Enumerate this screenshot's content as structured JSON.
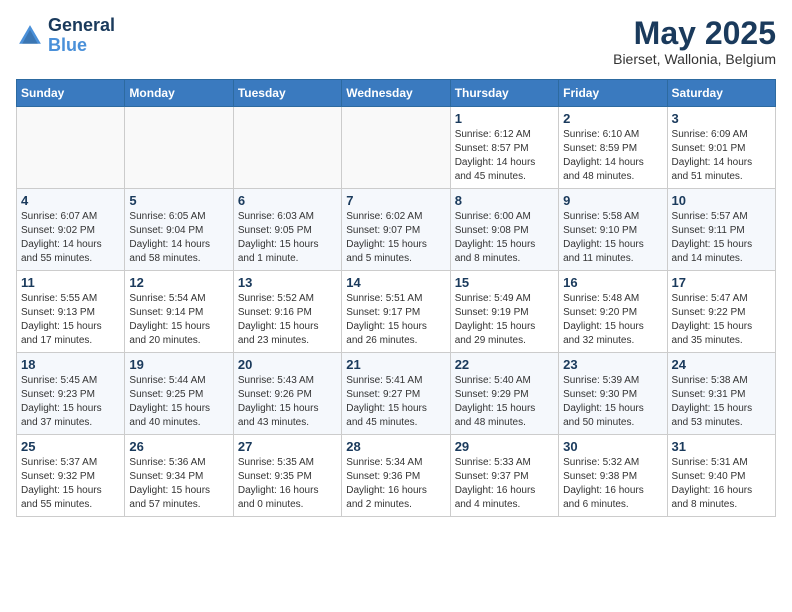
{
  "header": {
    "logo_line1": "General",
    "logo_line2": "Blue",
    "month_title": "May 2025",
    "subtitle": "Bierset, Wallonia, Belgium"
  },
  "days_of_week": [
    "Sunday",
    "Monday",
    "Tuesday",
    "Wednesday",
    "Thursday",
    "Friday",
    "Saturday"
  ],
  "weeks": [
    [
      {
        "day": "",
        "info": ""
      },
      {
        "day": "",
        "info": ""
      },
      {
        "day": "",
        "info": ""
      },
      {
        "day": "",
        "info": ""
      },
      {
        "day": "1",
        "info": "Sunrise: 6:12 AM\nSunset: 8:57 PM\nDaylight: 14 hours and 45 minutes."
      },
      {
        "day": "2",
        "info": "Sunrise: 6:10 AM\nSunset: 8:59 PM\nDaylight: 14 hours and 48 minutes."
      },
      {
        "day": "3",
        "info": "Sunrise: 6:09 AM\nSunset: 9:01 PM\nDaylight: 14 hours and 51 minutes."
      }
    ],
    [
      {
        "day": "4",
        "info": "Sunrise: 6:07 AM\nSunset: 9:02 PM\nDaylight: 14 hours and 55 minutes."
      },
      {
        "day": "5",
        "info": "Sunrise: 6:05 AM\nSunset: 9:04 PM\nDaylight: 14 hours and 58 minutes."
      },
      {
        "day": "6",
        "info": "Sunrise: 6:03 AM\nSunset: 9:05 PM\nDaylight: 15 hours and 1 minute."
      },
      {
        "day": "7",
        "info": "Sunrise: 6:02 AM\nSunset: 9:07 PM\nDaylight: 15 hours and 5 minutes."
      },
      {
        "day": "8",
        "info": "Sunrise: 6:00 AM\nSunset: 9:08 PM\nDaylight: 15 hours and 8 minutes."
      },
      {
        "day": "9",
        "info": "Sunrise: 5:58 AM\nSunset: 9:10 PM\nDaylight: 15 hours and 11 minutes."
      },
      {
        "day": "10",
        "info": "Sunrise: 5:57 AM\nSunset: 9:11 PM\nDaylight: 15 hours and 14 minutes."
      }
    ],
    [
      {
        "day": "11",
        "info": "Sunrise: 5:55 AM\nSunset: 9:13 PM\nDaylight: 15 hours and 17 minutes."
      },
      {
        "day": "12",
        "info": "Sunrise: 5:54 AM\nSunset: 9:14 PM\nDaylight: 15 hours and 20 minutes."
      },
      {
        "day": "13",
        "info": "Sunrise: 5:52 AM\nSunset: 9:16 PM\nDaylight: 15 hours and 23 minutes."
      },
      {
        "day": "14",
        "info": "Sunrise: 5:51 AM\nSunset: 9:17 PM\nDaylight: 15 hours and 26 minutes."
      },
      {
        "day": "15",
        "info": "Sunrise: 5:49 AM\nSunset: 9:19 PM\nDaylight: 15 hours and 29 minutes."
      },
      {
        "day": "16",
        "info": "Sunrise: 5:48 AM\nSunset: 9:20 PM\nDaylight: 15 hours and 32 minutes."
      },
      {
        "day": "17",
        "info": "Sunrise: 5:47 AM\nSunset: 9:22 PM\nDaylight: 15 hours and 35 minutes."
      }
    ],
    [
      {
        "day": "18",
        "info": "Sunrise: 5:45 AM\nSunset: 9:23 PM\nDaylight: 15 hours and 37 minutes."
      },
      {
        "day": "19",
        "info": "Sunrise: 5:44 AM\nSunset: 9:25 PM\nDaylight: 15 hours and 40 minutes."
      },
      {
        "day": "20",
        "info": "Sunrise: 5:43 AM\nSunset: 9:26 PM\nDaylight: 15 hours and 43 minutes."
      },
      {
        "day": "21",
        "info": "Sunrise: 5:41 AM\nSunset: 9:27 PM\nDaylight: 15 hours and 45 minutes."
      },
      {
        "day": "22",
        "info": "Sunrise: 5:40 AM\nSunset: 9:29 PM\nDaylight: 15 hours and 48 minutes."
      },
      {
        "day": "23",
        "info": "Sunrise: 5:39 AM\nSunset: 9:30 PM\nDaylight: 15 hours and 50 minutes."
      },
      {
        "day": "24",
        "info": "Sunrise: 5:38 AM\nSunset: 9:31 PM\nDaylight: 15 hours and 53 minutes."
      }
    ],
    [
      {
        "day": "25",
        "info": "Sunrise: 5:37 AM\nSunset: 9:32 PM\nDaylight: 15 hours and 55 minutes."
      },
      {
        "day": "26",
        "info": "Sunrise: 5:36 AM\nSunset: 9:34 PM\nDaylight: 15 hours and 57 minutes."
      },
      {
        "day": "27",
        "info": "Sunrise: 5:35 AM\nSunset: 9:35 PM\nDaylight: 16 hours and 0 minutes."
      },
      {
        "day": "28",
        "info": "Sunrise: 5:34 AM\nSunset: 9:36 PM\nDaylight: 16 hours and 2 minutes."
      },
      {
        "day": "29",
        "info": "Sunrise: 5:33 AM\nSunset: 9:37 PM\nDaylight: 16 hours and 4 minutes."
      },
      {
        "day": "30",
        "info": "Sunrise: 5:32 AM\nSunset: 9:38 PM\nDaylight: 16 hours and 6 minutes."
      },
      {
        "day": "31",
        "info": "Sunrise: 5:31 AM\nSunset: 9:40 PM\nDaylight: 16 hours and 8 minutes."
      }
    ]
  ]
}
